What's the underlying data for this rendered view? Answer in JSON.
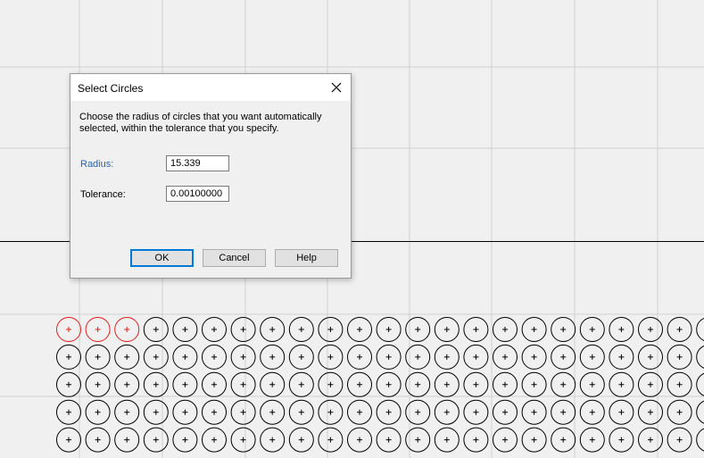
{
  "dialog": {
    "title": "Select Circles",
    "description": "Choose the radius of circles that you want automatically selected, within the tolerance that you specify.",
    "radius_label": "Radius:",
    "radius_value": "15.339",
    "tolerance_label": "Tolerance:",
    "tolerance_value": "0.00100000",
    "ok_label": "OK",
    "cancel_label": "Cancel",
    "help_label": "Help"
  },
  "drawing": {
    "circle_rows_visible": 5,
    "circle_columns_visible": 23,
    "selected_circles_in_first_row": 3,
    "circle_color": "#000000",
    "selected_circle_color": "#e0201c",
    "grid_color": "#d0d0d0",
    "background_color": "#f0f0f0"
  }
}
